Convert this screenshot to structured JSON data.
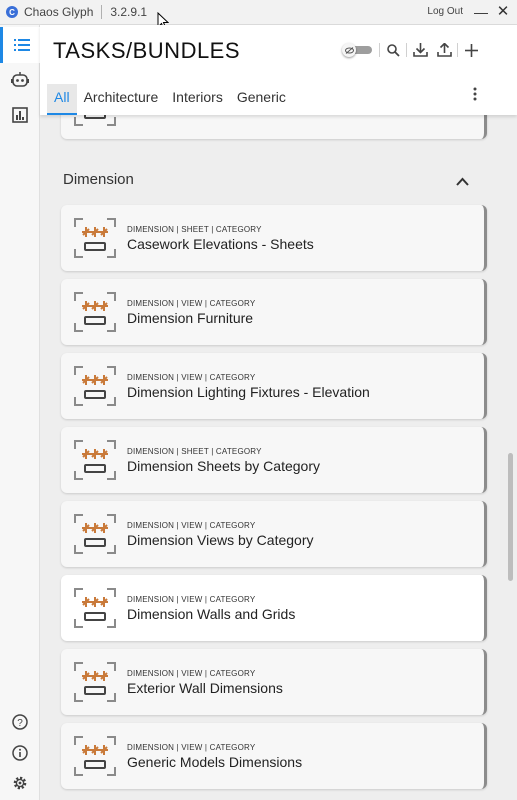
{
  "window": {
    "app_name": "Chaos Glyph",
    "version": "3.2.9.1",
    "logout_label": "Log Out",
    "minimize_glyph": "—",
    "close_glyph": "✕"
  },
  "rail": {
    "items": [
      {
        "icon": "list-icon",
        "active": true
      },
      {
        "icon": "robot-icon",
        "active": false
      },
      {
        "icon": "chart-icon",
        "active": false
      }
    ],
    "bottom": [
      "help-icon",
      "info-icon",
      "settings-icon"
    ]
  },
  "header": {
    "title": "TASKS/BUNDLES",
    "tools": [
      "visibility-toggle",
      "search-icon",
      "download-icon",
      "upload-icon",
      "add-icon"
    ],
    "tabs": [
      {
        "label": "All",
        "active": true
      },
      {
        "label": "Architecture",
        "active": false
      },
      {
        "label": "Interiors",
        "active": false
      },
      {
        "label": "Generic",
        "active": false
      }
    ]
  },
  "section": {
    "title": "Dimension",
    "expanded": true
  },
  "cards": [
    {
      "category": "DIMENSION | SHEET | CATEGORY",
      "name": "Casework Elevations - Sheets",
      "selected": false
    },
    {
      "category": "DIMENSION | VIEW | CATEGORY",
      "name": "Dimension Furniture",
      "selected": false
    },
    {
      "category": "DIMENSION | VIEW | CATEGORY",
      "name": "Dimension Lighting Fixtures - Elevation",
      "selected": false
    },
    {
      "category": "DIMENSION | SHEET | CATEGORY",
      "name": "Dimension Sheets by Category",
      "selected": false
    },
    {
      "category": "DIMENSION | VIEW | CATEGORY",
      "name": "Dimension Views by Category",
      "selected": false
    },
    {
      "category": "DIMENSION | VIEW | CATEGORY",
      "name": "Dimension Walls and Grids",
      "selected": true
    },
    {
      "category": "DIMENSION | VIEW | CATEGORY",
      "name": "Exterior Wall Dimensions",
      "selected": false
    },
    {
      "category": "DIMENSION | VIEW | CATEGORY",
      "name": "Generic Models Dimensions",
      "selected": false
    }
  ],
  "colors": {
    "accent": "#1e88e5",
    "dimension_orange": "#c97a3a",
    "card_edge": "#8c8c8c"
  }
}
